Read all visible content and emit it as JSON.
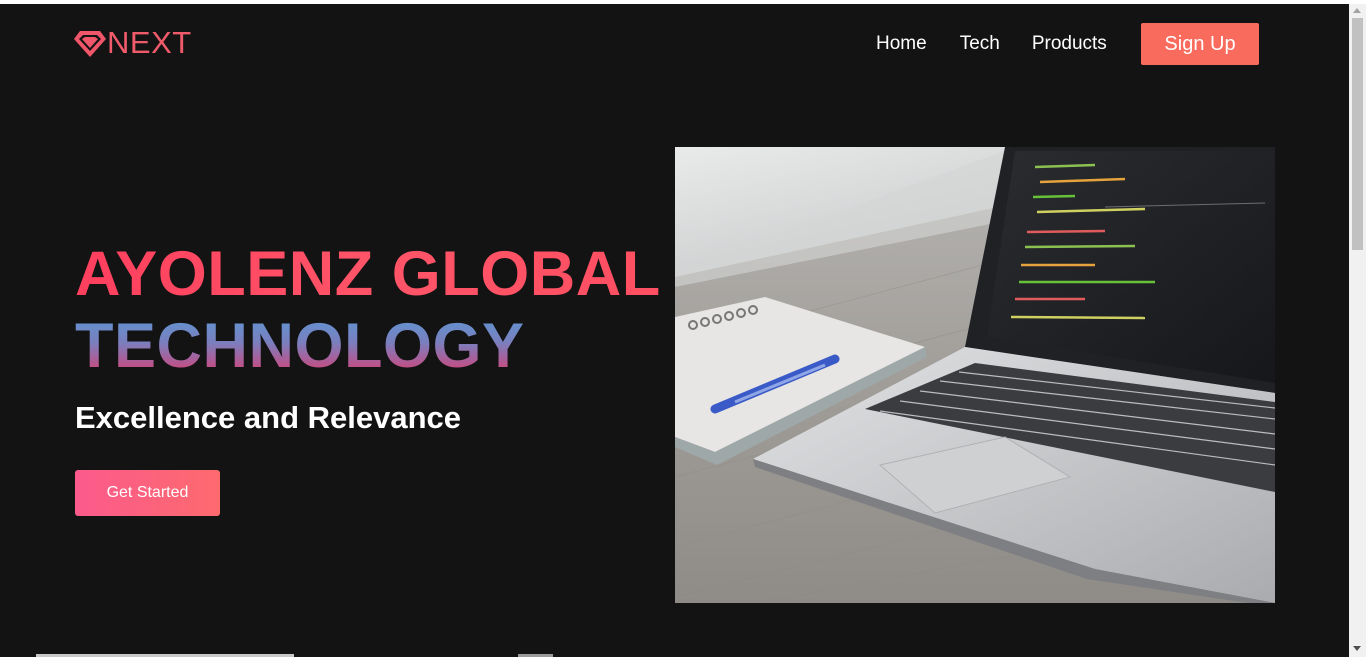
{
  "brand": {
    "name": "NEXT",
    "icon": "diamond-logo-icon",
    "color": "#f05b6b"
  },
  "nav": {
    "links": [
      "Home",
      "Tech",
      "Products"
    ],
    "signup_label": "Sign Up",
    "signup_color": "#f96b5d"
  },
  "hero": {
    "title_line1": "AYOLENZ GLOBAL",
    "title_line2": "TECHNOLOGY",
    "subtitle": "Excellence and Relevance",
    "cta_label": "Get Started",
    "image": "laptop-with-code-and-notebook-photo"
  },
  "colors": {
    "background": "#131313",
    "accent_pink": "#ff4d64",
    "accent_blue": "#5a9ad6"
  }
}
